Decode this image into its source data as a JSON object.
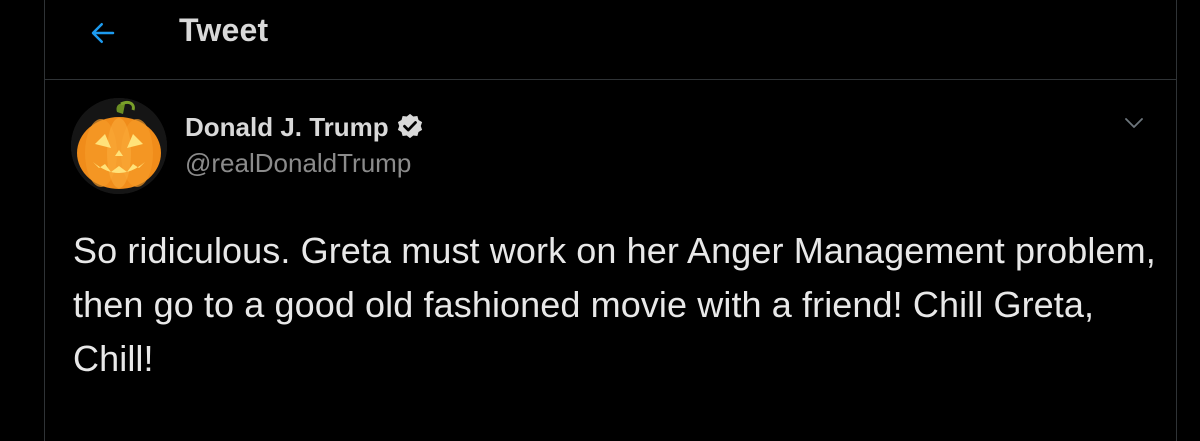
{
  "header": {
    "title": "Tweet",
    "back_icon": "arrow-left-icon",
    "accent_color": "#1d9bf0"
  },
  "tweet": {
    "author": {
      "name": "Donald J. Trump",
      "handle": "@realDonaldTrump",
      "verified": true,
      "avatar_icon": "jack-o-lantern-icon"
    },
    "menu_icon": "chevron-down-icon",
    "text": "So ridiculous. Greta must work on her Anger Management problem, then go to a good old fashioned movie with a friend! Chill Greta, Chill!"
  },
  "colors": {
    "background": "#000000",
    "border": "#2f3336",
    "primary_text": "#e8e8e8",
    "secondary_text": "#8b8b8b"
  }
}
